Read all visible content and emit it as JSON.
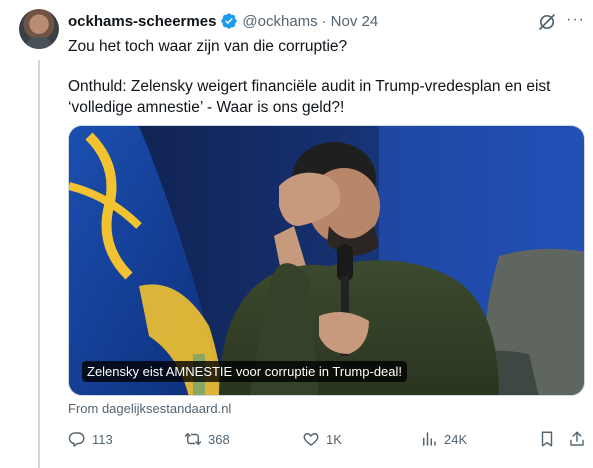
{
  "post": {
    "author_name": "ockhams-scheermes",
    "handle": "@ockhams",
    "separator": "·",
    "date": "Nov 24",
    "text_line1": "Zou het toch waar zijn van die corruptie?",
    "text_line2": "Onthuld: Zelensky weigert financiële audit in Trump-vredesplan en eist ‘volledige amnestie’ - Waar is ons geld?!",
    "card_caption": "Zelensky eist AMNESTIE voor corruptie in Trump-deal!",
    "card_source": "From dagelijksestandaard.nl",
    "more_label": "···"
  },
  "actions": {
    "replies": "113",
    "reposts": "368",
    "likes": "1K",
    "views": "24K"
  },
  "colors": {
    "verified": "#1d9bf0",
    "secondary_text": "#536471",
    "primary_text": "#0f1419"
  },
  "icons": [
    "grok-icon",
    "more-icon",
    "verified-badge-icon",
    "reply-icon",
    "retweet-icon",
    "like-icon",
    "views-icon",
    "bookmark-icon",
    "share-icon"
  ]
}
